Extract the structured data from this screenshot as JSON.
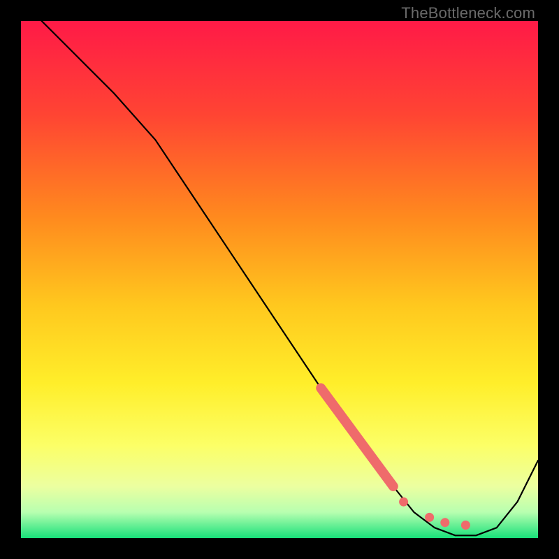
{
  "watermark": "TheBottleneck.com",
  "chart_data": {
    "type": "line",
    "title": "",
    "xlabel": "",
    "ylabel": "",
    "xlim": [
      0,
      100
    ],
    "ylim": [
      0,
      100
    ],
    "grid": false,
    "legend": false,
    "background_gradient": {
      "top_color": "#ff1a47",
      "mid_colors": [
        "#ff7a2a",
        "#ffd21e",
        "#ffff55",
        "#f7ff96"
      ],
      "bottom_color": "#1de47a"
    },
    "series": [
      {
        "name": "curve",
        "color": "#000000",
        "x": [
          4,
          10,
          18,
          26,
          34,
          42,
          50,
          58,
          66,
          72,
          76,
          80,
          84,
          88,
          92,
          96,
          100
        ],
        "y": [
          100,
          94,
          86,
          77,
          65,
          53,
          41,
          29,
          18,
          10,
          5,
          2,
          0.5,
          0.5,
          2,
          7,
          15
        ]
      }
    ],
    "highlight_segment": {
      "name": "red-thick-segment",
      "color": "#ef6b6b",
      "x": [
        58,
        72
      ],
      "y": [
        29,
        10
      ]
    },
    "dots": {
      "name": "red-dots",
      "color": "#ef6b6b",
      "points": [
        {
          "x": 74,
          "y": 7
        },
        {
          "x": 79,
          "y": 4
        },
        {
          "x": 82,
          "y": 3
        },
        {
          "x": 86,
          "y": 2.5
        }
      ]
    }
  }
}
